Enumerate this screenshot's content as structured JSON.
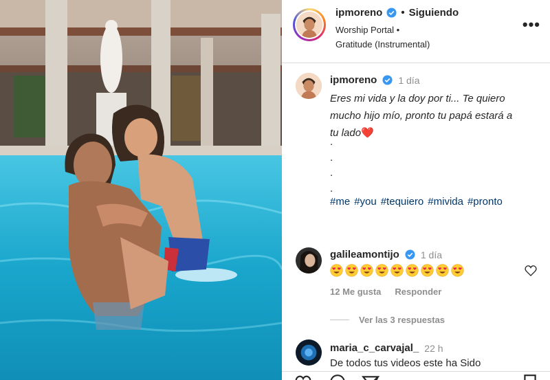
{
  "header": {
    "username": "ipmoreno",
    "separator": "•",
    "follow_status": "Siguiendo",
    "music_line1": "Worship Portal •",
    "music_line2": "Gratitude (Instrumental)",
    "more_label": "•••"
  },
  "caption": {
    "username": "ipmoreno",
    "time": "1 día",
    "text": "Eres mi vida y la doy por ti... Te quiero\nmucho hijo mío, pronto tu papá estará a\ntu lado",
    "heart": "❤️",
    "dots": ".\n.\n.\n.",
    "hashtags": [
      "#me",
      "#you",
      "#tequiero",
      "#mivida",
      "#pronto"
    ]
  },
  "comments": [
    {
      "username": "galileamontijo",
      "time": "1 día",
      "emoji_count": 9,
      "likes": "12 Me gusta",
      "reply_label": "Responder",
      "view_replies": "Ver las 3 respuestas"
    },
    {
      "username": "maria_c_carvajal_",
      "time": "22 h",
      "text": "De todos tus videos este ha Sido"
    }
  ],
  "colors": {
    "link": "#00376b",
    "verified": "#3897f0",
    "muted": "#8e8e8e",
    "pool": "#1ba7c9"
  }
}
